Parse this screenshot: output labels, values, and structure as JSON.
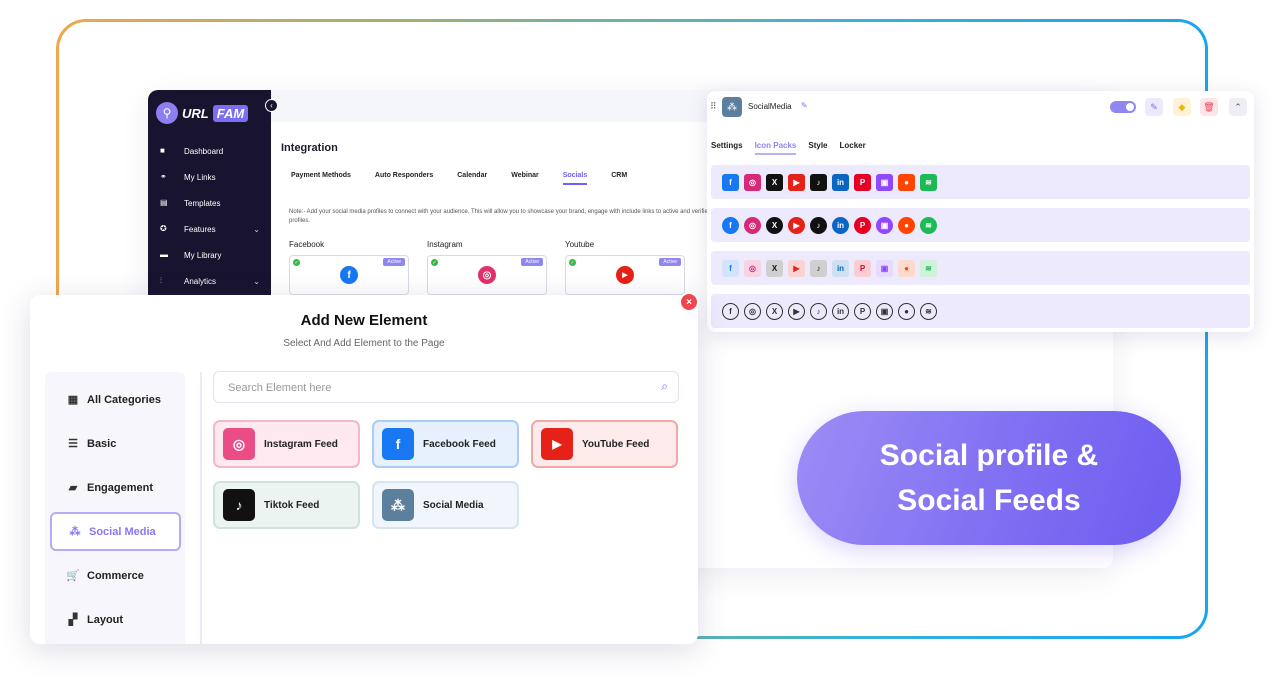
{
  "dashboard": {
    "logo_url": "URL",
    "logo_fam": "FAM",
    "nav": [
      {
        "label": "Dashboard",
        "icon": "dashboard-icon"
      },
      {
        "label": "My Links",
        "icon": "link-icon"
      },
      {
        "label": "Templates",
        "icon": "templates-icon"
      },
      {
        "label": "Features",
        "icon": "features-icon"
      },
      {
        "label": "My Library",
        "icon": "folder-icon"
      },
      {
        "label": "Analytics",
        "icon": "analytics-icon"
      }
    ],
    "title": "Integration",
    "tabs": [
      "Payment Methods",
      "Auto Responders",
      "Calendar",
      "Webinar",
      "Socials",
      "CRM"
    ],
    "active_tab": "Socials",
    "note": "Note:- Add your social media profiles to connect with your audience. This will allow you to showcase your brand, engage with include links to active and verified profiles.",
    "integrations": [
      {
        "label": "Facebook",
        "status": "Active",
        "color": "#1877f2",
        "glyph": "f"
      },
      {
        "label": "Instagram",
        "status": "Active",
        "color": "#e1306c",
        "glyph": "◎"
      },
      {
        "label": "Youtube",
        "status": "Active",
        "color": "#e62117",
        "glyph": "▶"
      }
    ]
  },
  "social_panel": {
    "title": "SocialMedia",
    "tabs": [
      "Settings",
      "Icon Packs",
      "Style",
      "Locker"
    ],
    "active_tab": "Icon Packs",
    "icons": [
      {
        "name": "facebook-icon",
        "glyph": "f",
        "color": "#1877f2"
      },
      {
        "name": "instagram-icon",
        "glyph": "◎",
        "color": "#d62976"
      },
      {
        "name": "x-icon",
        "glyph": "X",
        "color": "#111111"
      },
      {
        "name": "youtube-icon",
        "glyph": "▶",
        "color": "#e62117"
      },
      {
        "name": "tiktok-icon",
        "glyph": "♪",
        "color": "#111111"
      },
      {
        "name": "linkedin-icon",
        "glyph": "in",
        "color": "#0a66c2"
      },
      {
        "name": "pinterest-icon",
        "glyph": "P",
        "color": "#e60023"
      },
      {
        "name": "twitch-icon",
        "glyph": "▣",
        "color": "#9146ff"
      },
      {
        "name": "reddit-icon",
        "glyph": "●",
        "color": "#ff4500"
      },
      {
        "name": "spotify-icon",
        "glyph": "≋",
        "color": "#1db954"
      }
    ]
  },
  "modal": {
    "title": "Add New Element",
    "subtitle": "Select And Add Element to the Page",
    "search_placeholder": "Search Element here",
    "categories": [
      {
        "label": "All Categories",
        "icon": "grid-icon"
      },
      {
        "label": "Basic",
        "icon": "list-icon"
      },
      {
        "label": "Engagement",
        "icon": "chat-icon"
      },
      {
        "label": "Social Media",
        "icon": "social-icon"
      },
      {
        "label": "Commerce",
        "icon": "cart-icon"
      },
      {
        "label": "Layout",
        "icon": "layout-icon"
      }
    ],
    "active_category": "Social Media",
    "elements": [
      {
        "label": "Instagram Feed",
        "icon": "instagram-icon",
        "color": "#e83e8c"
      },
      {
        "label": "Facebook Feed",
        "icon": "facebook-icon",
        "color": "#1877f2"
      },
      {
        "label": "YouTube Feed",
        "icon": "youtube-icon",
        "color": "#e62117"
      },
      {
        "label": "Tiktok Feed",
        "icon": "tiktok-icon",
        "color": "#111111"
      },
      {
        "label": "Social Media",
        "icon": "social-media-icon",
        "color": "#5c7f9e"
      }
    ]
  },
  "cta": {
    "line1": "Social profile &",
    "line2": "Social Feeds"
  }
}
